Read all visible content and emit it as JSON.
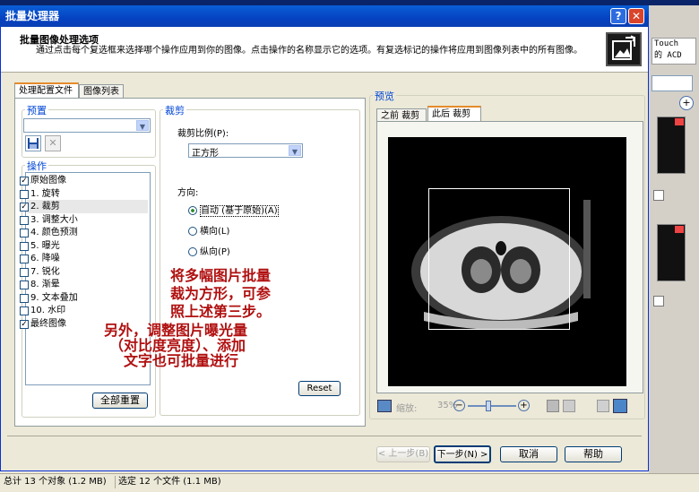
{
  "dialog": {
    "title": "批量处理器",
    "help_btn": "?",
    "close_btn": "✕"
  },
  "header": {
    "title": "批量图像处理选项",
    "description": "通过点击每个复选框来选择哪个操作应用到你的图像。点击操作的名称显示它的选项。有复选标记的操作将应用到图像列表中的所有图像。"
  },
  "tabs": [
    "处理配置文件",
    "图像列表"
  ],
  "preset": {
    "label": "预置"
  },
  "operations": {
    "label": "操作",
    "items": [
      {
        "label": "原始图像",
        "checked": true
      },
      {
        "label": "1.  旋转",
        "checked": false
      },
      {
        "label": "2.  裁剪",
        "checked": true
      },
      {
        "label": "3.  调整大小",
        "checked": false
      },
      {
        "label": "4.  颜色预测",
        "checked": false
      },
      {
        "label": "5.  曝光",
        "checked": false
      },
      {
        "label": "6.  降噪",
        "checked": false
      },
      {
        "label": "7.  锐化",
        "checked": false
      },
      {
        "label": "8.  渐晕",
        "checked": false
      },
      {
        "label": "9.  文本叠加",
        "checked": false
      },
      {
        "label": "10.  水印",
        "checked": false
      },
      {
        "label": "最终图像",
        "checked": true
      }
    ],
    "reset_all": "全部重置"
  },
  "crop": {
    "label": "裁剪",
    "ratio_label": "裁剪比例(P):",
    "ratio_value": "正方形",
    "direction_label": "方向:",
    "options": [
      "自动 (基于原始)(A)",
      "横向(L)",
      "纵向(P)"
    ],
    "selected": 0,
    "reset": "Reset"
  },
  "preview": {
    "label": "预览",
    "tabs": [
      "之前 裁剪",
      "此后 裁剪"
    ],
    "zoom_label": "缩放:",
    "zoom_value": "35%"
  },
  "annotations": [
    "将多幅图片批量",
    "裁为方形，可参",
    "照上述第三步。",
    "另外，调整图片曝光量",
    "（对比度亮度）、添加",
    "文字也可批量进行"
  ],
  "footer": {
    "back": "< 上一步(B)",
    "next": "下一步(N) >",
    "cancel": "取消",
    "help": "帮助"
  },
  "status": {
    "total": "总计 13 个对象 (1.2 MB)",
    "selected": "选定 12 个文件 (1.1 MB)"
  },
  "background": {
    "touch_text": "Touch",
    "acd_text": "的 ACD",
    "plus": "+"
  }
}
